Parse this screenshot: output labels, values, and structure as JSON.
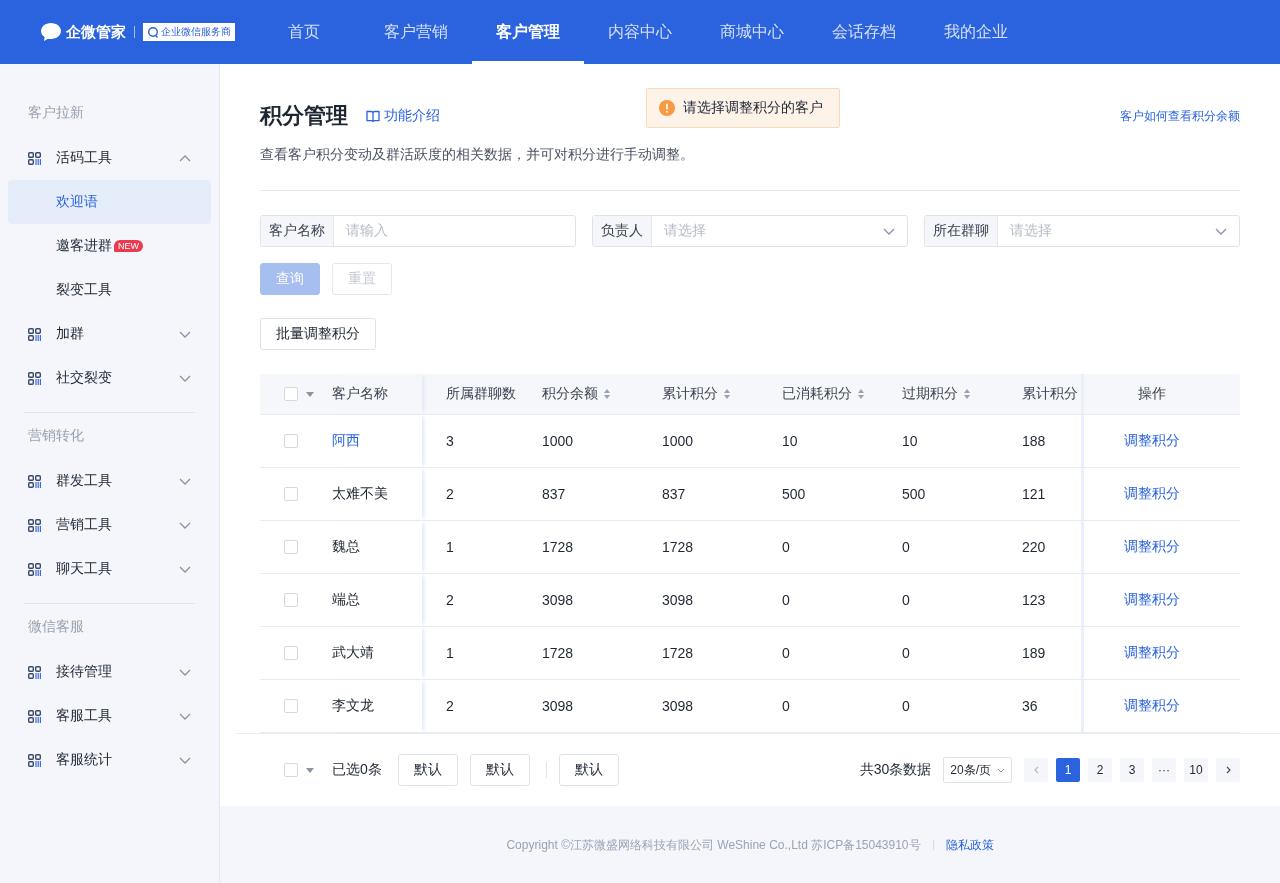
{
  "header": {
    "logo_text": "企微管家",
    "partner_badge": "企业微信服务商",
    "nav": [
      {
        "label": "首页",
        "selected": false
      },
      {
        "label": "客户营销",
        "selected": false
      },
      {
        "label": "客户管理",
        "selected": true
      },
      {
        "label": "内容中心",
        "selected": false
      },
      {
        "label": "商城中心",
        "selected": false
      },
      {
        "label": "会话存档",
        "selected": false
      },
      {
        "label": "我的企业",
        "selected": false
      }
    ]
  },
  "sidebar": {
    "groups": [
      {
        "title": "客户拉新",
        "items": [
          {
            "label": "活码工具",
            "expanded": true,
            "children": [
              {
                "label": "欢迎语",
                "selected": true
              },
              {
                "label": "邀客进群",
                "selected": false,
                "badge": "NEW"
              },
              {
                "label": "裂变工具",
                "selected": false
              }
            ]
          },
          {
            "label": "加群",
            "expanded": false
          },
          {
            "label": "社交裂变",
            "expanded": false
          }
        ]
      },
      {
        "title": "营销转化",
        "items": [
          {
            "label": "群发工具",
            "expanded": false
          },
          {
            "label": "营销工具",
            "expanded": false
          },
          {
            "label": "聊天工具",
            "expanded": false
          }
        ]
      },
      {
        "title": "微信客服",
        "items": [
          {
            "label": "接待管理",
            "expanded": false
          },
          {
            "label": "客服工具",
            "expanded": false
          },
          {
            "label": "客服统计",
            "expanded": false
          }
        ]
      }
    ]
  },
  "page": {
    "title": "积分管理",
    "intro_link": "功能介绍",
    "toast": "请选择调整积分的客户",
    "help_link": "客户如何查看积分余额",
    "description": "查看客户积分变动及群活跃度的相关数据，并可对积分进行手动调整。"
  },
  "filters": [
    {
      "label": "客户名称",
      "placeholder": "请输入",
      "kind": "input"
    },
    {
      "label": "负责人",
      "placeholder": "请选择",
      "kind": "select"
    },
    {
      "label": "所在群聊",
      "placeholder": "请选择",
      "kind": "select"
    }
  ],
  "filter_buttons": [
    {
      "label": "查询",
      "kind": "primary",
      "disabled": true
    },
    {
      "label": "重置",
      "kind": "default",
      "disabled": true
    }
  ],
  "batch_button": "批量调整积分",
  "table": {
    "select_all_checked": false,
    "columns": [
      {
        "label": "客户名称",
        "kind": "plain"
      },
      {
        "label": "所属群聊数",
        "kind": "plain"
      },
      {
        "label": "积分余额",
        "kind": "sortable"
      },
      {
        "label": "累计积分",
        "kind": "sortable"
      },
      {
        "label": "已消耗积分",
        "kind": "sortable"
      },
      {
        "label": "过期积分",
        "kind": "sortable"
      },
      {
        "label": "累计积分",
        "kind": "plain"
      },
      {
        "label": "操作",
        "kind": "plain"
      }
    ],
    "rows": [
      {
        "checked": false,
        "link": true,
        "cells": [
          "阿西",
          "3",
          "1000",
          "1000",
          "10",
          "10",
          "188"
        ],
        "action": "调整积分"
      },
      {
        "checked": false,
        "link": false,
        "cells": [
          "太难不美",
          "2",
          "837",
          "837",
          "500",
          "500",
          "121"
        ],
        "action": "调整积分"
      },
      {
        "checked": false,
        "link": false,
        "cells": [
          "魏总",
          "1",
          "1728",
          "1728",
          "0",
          "0",
          "220"
        ],
        "action": "调整积分"
      },
      {
        "checked": false,
        "link": false,
        "cells": [
          "端总",
          "2",
          "3098",
          "3098",
          "0",
          "0",
          "123"
        ],
        "action": "调整积分"
      },
      {
        "checked": false,
        "link": false,
        "cells": [
          "武大靖",
          "1",
          "1728",
          "1728",
          "0",
          "0",
          "189"
        ],
        "action": "调整积分"
      },
      {
        "checked": false,
        "link": false,
        "cells": [
          "李文龙",
          "2",
          "3098",
          "3098",
          "0",
          "0",
          "36"
        ],
        "action": "调整积分"
      }
    ]
  },
  "bulk_bar": {
    "select_all_checked": false,
    "selected_text": "已选0条",
    "buttons": [
      "默认",
      "默认",
      "默认"
    ],
    "total": "共30条数据",
    "page_size": "20条/页",
    "pages": [
      {
        "label": "1",
        "selected": true
      },
      {
        "label": "2",
        "selected": false
      },
      {
        "label": "3",
        "selected": false
      },
      {
        "label": "···",
        "selected": false
      },
      {
        "label": "10",
        "selected": false
      }
    ]
  },
  "footer": {
    "copyright": "Copyright ©江苏微盛网络科技有限公司 WeShine Co.,Ltd 苏ICP备15043910号",
    "privacy_link": "隐私政策"
  }
}
